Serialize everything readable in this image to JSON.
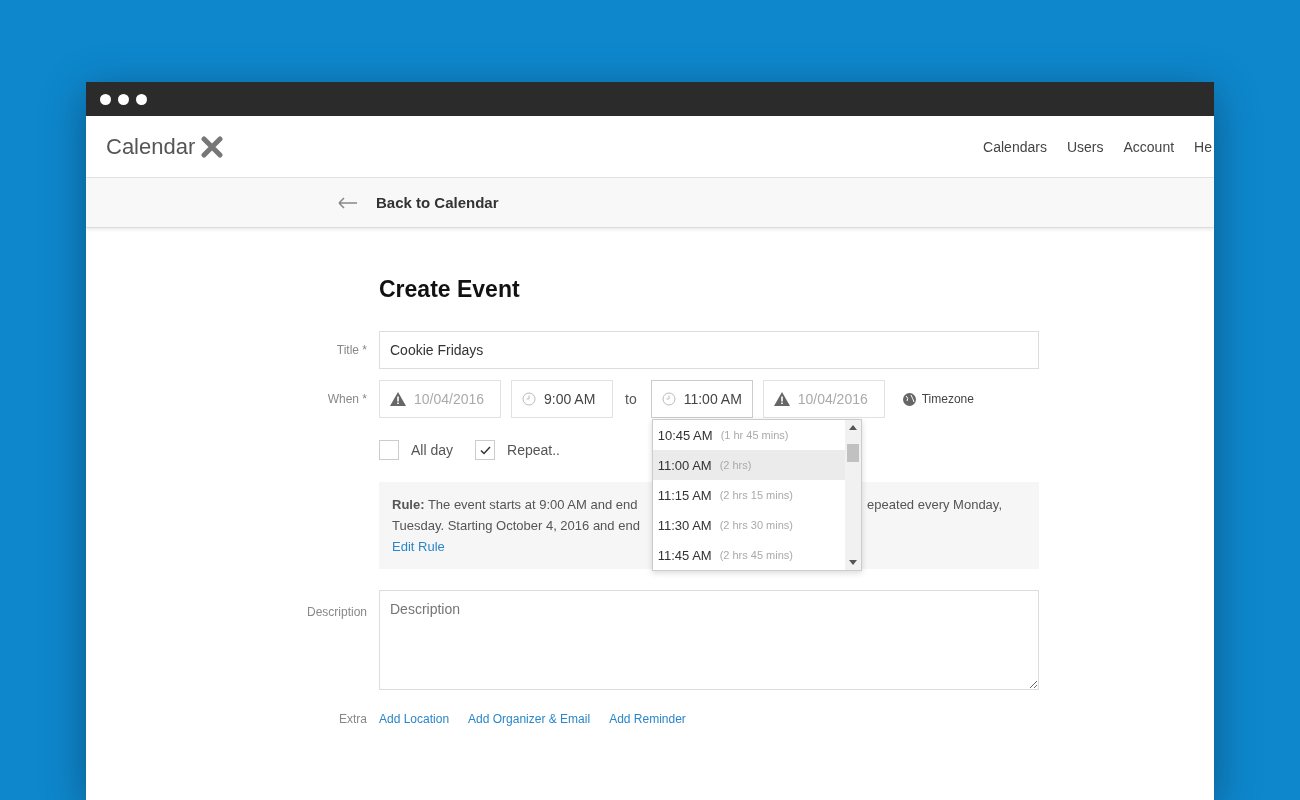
{
  "header": {
    "logo": "Calendar",
    "nav": [
      "Calendars",
      "Users",
      "Account",
      "He"
    ]
  },
  "subbar": {
    "back": "Back to Calendar"
  },
  "form": {
    "heading": "Create Event",
    "title": {
      "label": "Title *",
      "value": "Cookie Fridays"
    },
    "when": {
      "label": "When *",
      "start_date": "10/04/2016",
      "start_time": "9:00 AM",
      "to": "to",
      "end_time": "11:00 AM",
      "end_date": "10/04/2016",
      "timezone": "Timezone"
    },
    "time_options": [
      {
        "time": "10:45 AM",
        "duration": "(1 hr 45 mins)",
        "selected": false
      },
      {
        "time": "11:00 AM",
        "duration": "(2 hrs)",
        "selected": true
      },
      {
        "time": "11:15 AM",
        "duration": "(2 hrs 15 mins)",
        "selected": false
      },
      {
        "time": "11:30 AM",
        "duration": "(2 hrs 30 mins)",
        "selected": false
      },
      {
        "time": "11:45 AM",
        "duration": "(2 hrs 45 mins)",
        "selected": false
      }
    ],
    "checkboxes": [
      {
        "label": "All day",
        "checked": false
      },
      {
        "label": "Repeat..",
        "checked": true
      }
    ],
    "rule": {
      "line1": "**Rule:** The event starts at 9:00 AM and end",
      "line1_right": "epeated every Monday,",
      "line2": "Tuesday. Starting October 4, 2016 and end",
      "link": "Edit Rule"
    },
    "description": {
      "label": "Description",
      "placeholder": "Description"
    },
    "extra": {
      "label": "Extra",
      "links": [
        "Add Location",
        "Add Organizer & Email",
        "Add Reminder"
      ]
    }
  }
}
